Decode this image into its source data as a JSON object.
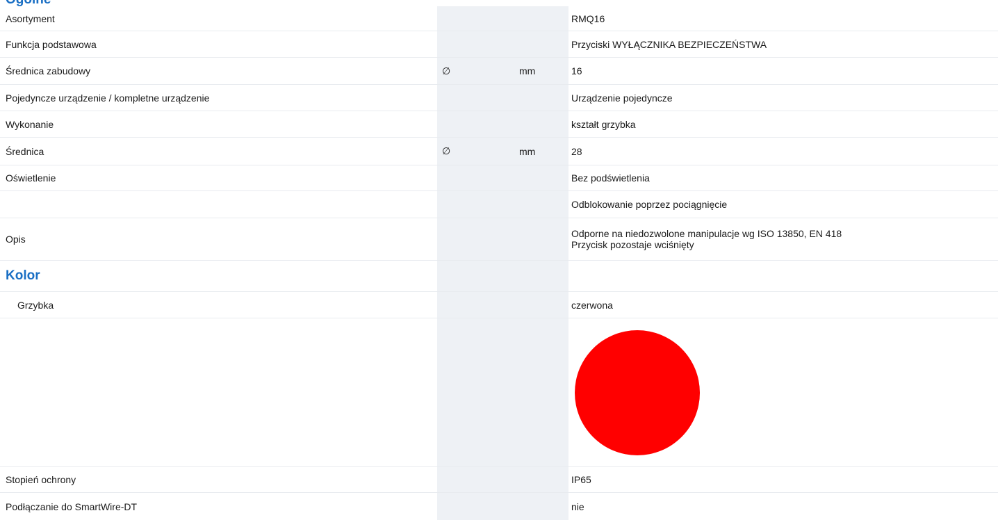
{
  "partial_heading": "Ogólne",
  "rows": [
    {
      "label": "Asortyment",
      "symbol": "",
      "unit": "",
      "value": "RMQ16"
    },
    {
      "label": "Funkcja podstawowa",
      "symbol": "",
      "unit": "",
      "value": "Przyciski WYŁĄCZNIKA BEZPIECZEŃSTWA"
    },
    {
      "label": "Średnica zabudowy",
      "symbol": "∅",
      "unit": "mm",
      "value": "16"
    },
    {
      "label": "Pojedyncze urządzenie / kompletne urządzenie",
      "symbol": "",
      "unit": "",
      "value": "Urządzenie pojedyncze"
    },
    {
      "label": "Wykonanie",
      "symbol": "",
      "unit": "",
      "value": "kształt grzybka"
    },
    {
      "label": "Średnica",
      "symbol": "∅",
      "unit": "mm",
      "value": "28"
    },
    {
      "label": "Oświetlenie",
      "symbol": "",
      "unit": "",
      "value": "Bez podświetlenia"
    },
    {
      "label": "",
      "symbol": "",
      "unit": "",
      "value": "Odblokowanie poprzez pociągnięcie"
    },
    {
      "label": "Opis",
      "symbol": "",
      "unit": "",
      "value_line1": "Odporne na niedozwolone manipulacje wg ISO 13850, EN 418",
      "value_line2": "Przycisk pozostaje wciśnięty"
    }
  ],
  "section_color": {
    "title": "Kolor",
    "mushroom_label": "Grzybka",
    "mushroom_value": "czerwona",
    "swatch_color": "#ff0000"
  },
  "rows_after": [
    {
      "label": "Stopień ochrony",
      "value": "IP65"
    },
    {
      "label": "Podłączanie do SmartWire-DT",
      "value": "nie"
    }
  ]
}
